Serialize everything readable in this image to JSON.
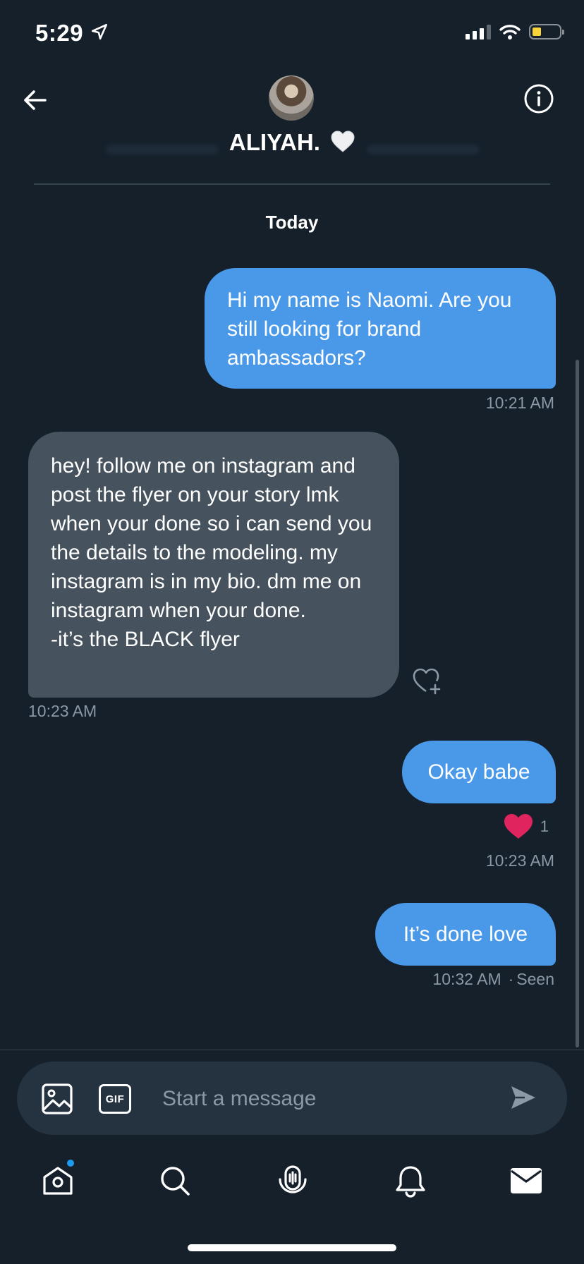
{
  "status_bar": {
    "time": "5:29",
    "icons": [
      "location-arrow-icon",
      "signal-icon",
      "wifi-icon",
      "battery-icon"
    ],
    "battery_color": "#f6d43a"
  },
  "header": {
    "name": "ALIYAH.",
    "name_emoji": "white-heart-icon",
    "back_icon": "arrow-left-icon",
    "info_icon": "info-circle-icon"
  },
  "conversation": {
    "day_label": "Today",
    "messages": [
      {
        "direction": "outgoing",
        "text": "Hi my name is Naomi. Are you still looking for brand ambassadors?",
        "time": "10:21 AM"
      },
      {
        "direction": "incoming",
        "text": "hey! follow me on instagram and post the flyer on your story lmk when your done so i can send you the details to the modeling. my instagram is in my bio. dm me on instagram when your done.\n-it’s the BLACK flyer",
        "time": "10:23 AM"
      },
      {
        "direction": "outgoing",
        "text": "Okay babe",
        "time": "10:23 AM",
        "reaction_count": "1"
      },
      {
        "direction": "outgoing",
        "text": "It’s done love",
        "time": "10:32 AM",
        "status": "Seen",
        "separator": "·"
      }
    ]
  },
  "composer": {
    "placeholder": "Start a message",
    "gif_label": "GIF"
  },
  "tab_bar": {
    "tabs": [
      "home-icon",
      "search-icon",
      "spaces-icon",
      "notifications-icon",
      "messages-icon"
    ]
  },
  "colors": {
    "background": "#15202b",
    "outgoing_bubble": "#4a99e9",
    "incoming_bubble": "#46535e",
    "reaction_heart": "#e0245e",
    "muted_text": "#8b98a5"
  }
}
